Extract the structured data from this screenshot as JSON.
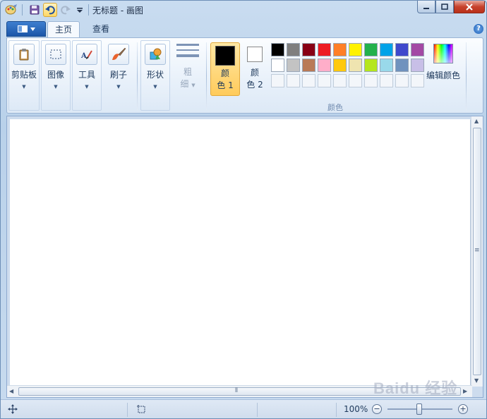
{
  "window": {
    "title": "无标题 - 画图"
  },
  "quick_access": {
    "items": [
      "save-icon",
      "undo-icon",
      "redo-icon",
      "customize-dropdown-icon"
    ]
  },
  "tabs": [
    {
      "label": "主页",
      "active": true
    },
    {
      "label": "查看",
      "active": false
    }
  ],
  "ribbon": {
    "clipboard": {
      "label": "剪贴板"
    },
    "image": {
      "label": "图像"
    },
    "tools": {
      "label": "工具"
    },
    "brushes": {
      "label": "刷子"
    },
    "shapes": {
      "label": "形状"
    },
    "thickness": {
      "line1": "粗",
      "line2": "细"
    },
    "color1": {
      "line1": "颜",
      "line2": "色 1",
      "value": "#000000"
    },
    "color2": {
      "line1": "颜",
      "line2": "色 2",
      "value": "#ffffff"
    },
    "colors_group_label": "颜色",
    "edit_colors": {
      "label": "编辑颜色"
    },
    "palette_row1": [
      "#000000",
      "#7f7f7f",
      "#880015",
      "#ed1c24",
      "#ff7f27",
      "#fff200",
      "#22b14c",
      "#00a2e8",
      "#3f48cc",
      "#a349a4"
    ],
    "palette_row2": [
      "#ffffff",
      "#c3c3c3",
      "#b97a57",
      "#ffaec9",
      "#ffc90e",
      "#efe4b0",
      "#b5e61d",
      "#99d9ea",
      "#7092be",
      "#c8bfe7"
    ]
  },
  "status": {
    "zoom": "100%"
  },
  "watermark": "Baidu 经验"
}
